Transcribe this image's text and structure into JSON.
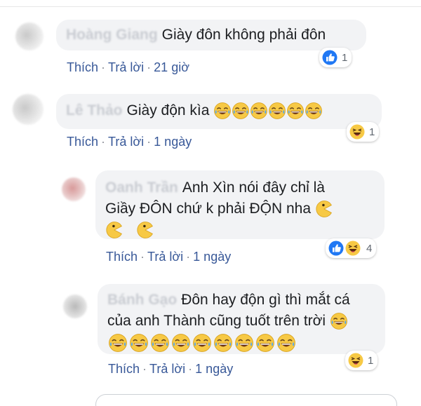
{
  "comments": [
    {
      "author": "Hoàng Giang",
      "text": "Giày đôn không phải đôn",
      "like_label": "Thích",
      "reply_label": "Trả lời",
      "time": "21 giờ",
      "reaction_count": "1",
      "reaction_icons": [
        "like-icon"
      ]
    },
    {
      "author": "Lê Thảo",
      "text": "Giày độn kìa",
      "like_label": "Thích",
      "reply_label": "Trả lời",
      "time": "1 ngày",
      "reaction_count": "1",
      "reaction_icons": [
        "haha-icon"
      ]
    },
    {
      "author": "Oanh Trần",
      "text_line1": "Anh Xìn nói đây chỉ là",
      "text_line2": "Giầy ĐÔN chứ k phải ĐỘN nha",
      "like_label": "Thích",
      "reply_label": "Trả lời",
      "time": "1 ngày",
      "reaction_count": "4",
      "reaction_icons": [
        "like-icon",
        "haha-icon"
      ]
    },
    {
      "author": "Bánh Gạo",
      "text_line1": "Đôn hay độn gì thì mắt cá",
      "text_line2": "của anh Thành cũng tuốt trên trời",
      "like_label": "Thích",
      "reply_label": "Trả lời",
      "time": "1 ngày",
      "reaction_count": "1",
      "reaction_icons": [
        "haha-icon"
      ]
    }
  ],
  "colors": {
    "link": "#385898",
    "bubble": "#f2f3f5",
    "like_blue": "#2078f4",
    "emoji_yellow": "#f7c945"
  }
}
